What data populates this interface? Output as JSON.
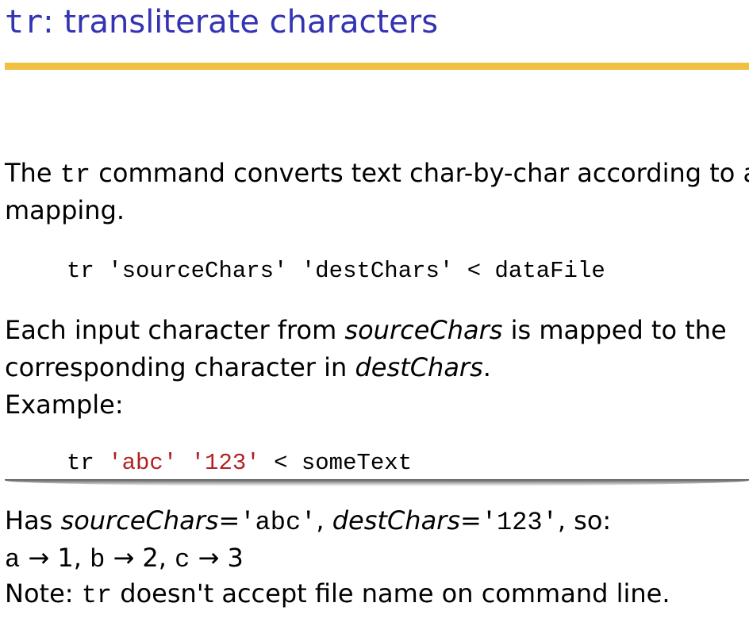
{
  "title": {
    "command": "tr",
    "text": ": transliterate characters"
  },
  "accent_color": "#f0c040",
  "title_color": "#3333b3",
  "intro": {
    "p1": "The ",
    "cmd": "tr",
    "p2": " command converts text char-by-char according to a",
    "line2": "mapping."
  },
  "usage": {
    "cmd": "tr",
    "arg1": "'sourceChars'",
    "arg2": "'destChars'",
    "rest": "< dataFile"
  },
  "desc": {
    "p1": "Each input character from ",
    "src": "sourceChars",
    "p2": " is mapped to the",
    "p3": "corresponding character in ",
    "dst": "destChars",
    "p4": ".",
    "example": "Example:"
  },
  "example_code": {
    "cmd": "tr",
    "arg1": "'abc'",
    "arg2": "'123'",
    "rest": "< someText"
  },
  "explain": {
    "p1": "Has ",
    "src": "sourceChars",
    "eq1": "=",
    "val1": "'abc'",
    "comma": ", ",
    "dst": "destChars",
    "eq2": "=",
    "val2": "'123'",
    "so": ", so:",
    "mapping": [
      {
        "from": "a",
        "to": "1"
      },
      {
        "from": "b",
        "to": "2"
      },
      {
        "from": "c",
        "to": "3"
      }
    ],
    "note1": "Note: ",
    "note_cmd": "tr",
    "note2": " doesn't accept file name on command line."
  }
}
